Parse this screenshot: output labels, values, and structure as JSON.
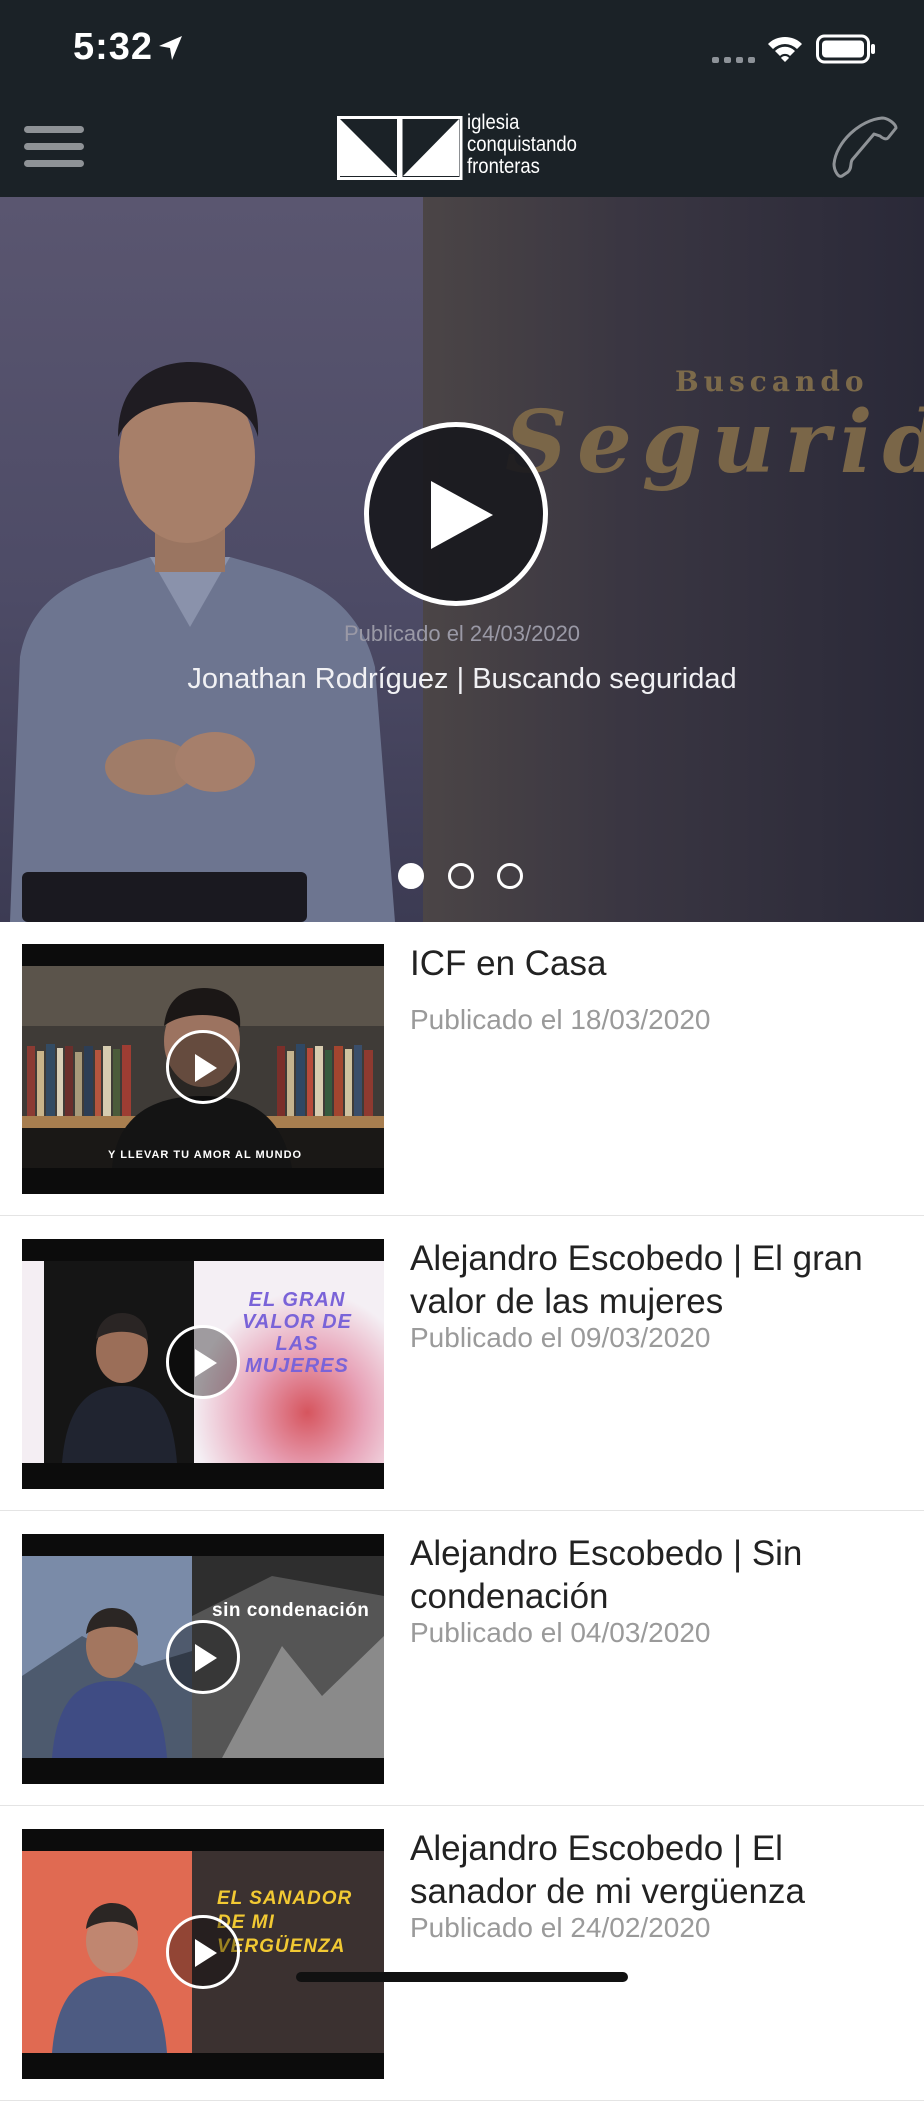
{
  "status_bar": {
    "time": "5:32"
  },
  "header": {
    "logo_lines": [
      "iglesia",
      "conquistando",
      "fronteras"
    ]
  },
  "hero": {
    "background_text_sub": "Buscando",
    "background_text_title": "Segurid",
    "date": "Publicado el 24/03/2020",
    "title": "Jonathan Rodríguez | Buscando seguridad",
    "carousel_active_index": 0,
    "carousel_count": 3
  },
  "videos": [
    {
      "title": "ICF en Casa",
      "date": "Publicado el 18/03/2020",
      "thumb_caption": "Y LLEVAR TU AMOR AL MUNDO"
    },
    {
      "title": "Alejandro Escobedo | El gran valor de las mujeres",
      "date": "Publicado el 09/03/2020",
      "thumb_caption": "EL GRAN VALOR DE LAS MUJERES"
    },
    {
      "title": "Alejandro Escobedo | Sin condenación",
      "date": "Publicado el 04/03/2020",
      "thumb_caption": "sin condenación"
    },
    {
      "title": "Alejandro Escobedo | El sanador de mi vergüenza",
      "date": "Publicado el 24/02/2020",
      "thumb_caption": "EL SANADOR DE MI VERGÜENZA"
    }
  ],
  "colors": {
    "header_bg": "#1b2227",
    "accent_gold": "#7a6648",
    "list_title": "#222222",
    "list_date": "#9a9a9a"
  },
  "icons": [
    "location-arrow-icon",
    "signal-icon",
    "wifi-icon",
    "battery-icon",
    "hamburger-menu-icon",
    "phone-icon",
    "play-icon"
  ]
}
